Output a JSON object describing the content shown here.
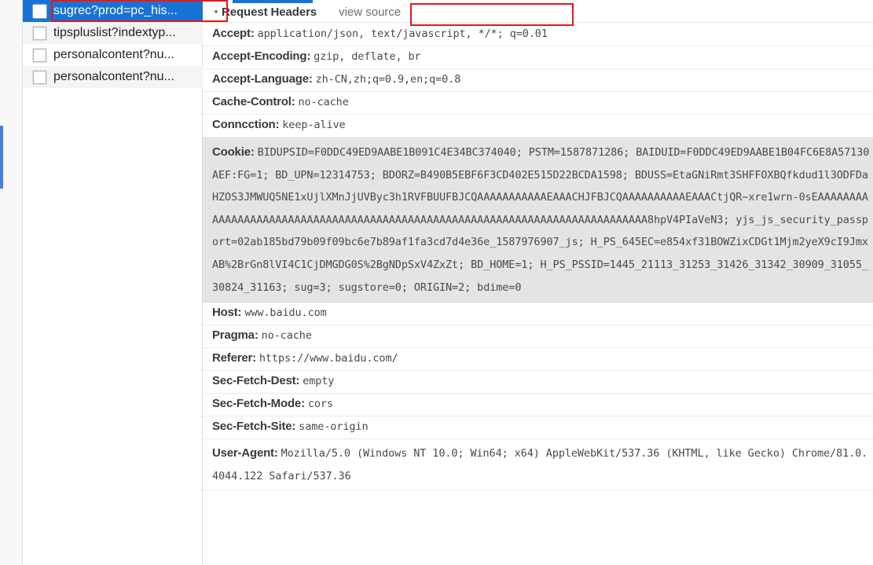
{
  "sidebar": {
    "items": [
      {
        "label": "sugrec?prod=pc_his...",
        "selected": true
      },
      {
        "label": "tipspluslist?indextyp...",
        "selected": false
      },
      {
        "label": "personalcontent?nu...",
        "selected": false
      },
      {
        "label": "personalcontent?nu...",
        "selected": false
      }
    ]
  },
  "panel": {
    "twisty": "▾",
    "section_title": "Request Headers",
    "view_source_label": "view source",
    "headers": [
      {
        "name": "Accept",
        "value": "application/json, text/javascript, */*; q=0.01",
        "highlight": false
      },
      {
        "name": "Accept-Encoding",
        "value": "gzip, deflate, br",
        "highlight": false
      },
      {
        "name": "Accept-Language",
        "value": "zh-CN,zh;q=0.9,en;q=0.8",
        "highlight": false
      },
      {
        "name": "Cache-Control",
        "value": "no-cache",
        "highlight": false
      },
      {
        "name": "Conncction",
        "value": "keep-alive",
        "highlight": false
      },
      {
        "name": "Cookie",
        "value": "BIDUPSID=F0DDC49ED9AABE1B091C4E34BC374040; PSTM=1587871286; BAIDUID=F0DDC49ED9AABE1B04FC6E8A57130AEF:FG=1; BD_UPN=12314753; BDORZ=B490B5EBF6F3CD402E515D22BCDA1598; BDUSS=EtaGNiRmt3SHFFOXBQfkdud1l3ODFDaHZOS3JMWUQ5NE1xUjlXMnJjUVByc3h1RVFBUUFBJCQAAAAAAAAAAAEAAACHJFBJCQAAAAAAAAAAEAAACtjQR~xre1wrn-0sEAAAAAAAAAAAAAAAAAAAAAAAAAAAAAAAAAAAAAAAAAAAAAAAAAAAAAAAAAAAAAAAAAAAAAAAAAAAAA8hpV4PIaVeN3; yjs_js_security_passport=02ab185bd79b09f09bc6e7b89af1fa3cd7d4e36e_1587976907_js; H_PS_645EC=e854xf31BOWZixCDGt1Mjm2yeX9cI9JmxAB%2BrGn8lVI4C1CjDMGDG0S%2BgNDpSxV4ZxZt; BD_HOME=1; H_PS_PSSID=1445_21113_31253_31426_31342_30909_31055_30824_31163; sug=3; sugstore=0; ORIGIN=2; bdime=0",
        "highlight": true
      },
      {
        "name": "Host",
        "value": "www.baidu.com",
        "highlight": false
      },
      {
        "name": "Pragma",
        "value": "no-cache",
        "highlight": false
      },
      {
        "name": "Referer",
        "value": "https://www.baidu.com/",
        "highlight": false
      },
      {
        "name": "Sec-Fetch-Dest",
        "value": "empty",
        "highlight": false
      },
      {
        "name": "Sec-Fetch-Mode",
        "value": "cors",
        "highlight": false
      },
      {
        "name": "Sec-Fetch-Site",
        "value": "same-origin",
        "highlight": false
      },
      {
        "name": "User-Agent",
        "value": "Mozilla/5.0 (Windows NT 10.0; Win64; x64) AppleWebKit/537.36 (KHTML, like Gecko) Chrome/81.0.4044.122 Safari/537.36",
        "highlight": false
      }
    ]
  },
  "colors": {
    "selection_blue": "#1a73d4",
    "annotation_red": "#e01b1b",
    "cookie_highlight": "#e4e4e4"
  }
}
